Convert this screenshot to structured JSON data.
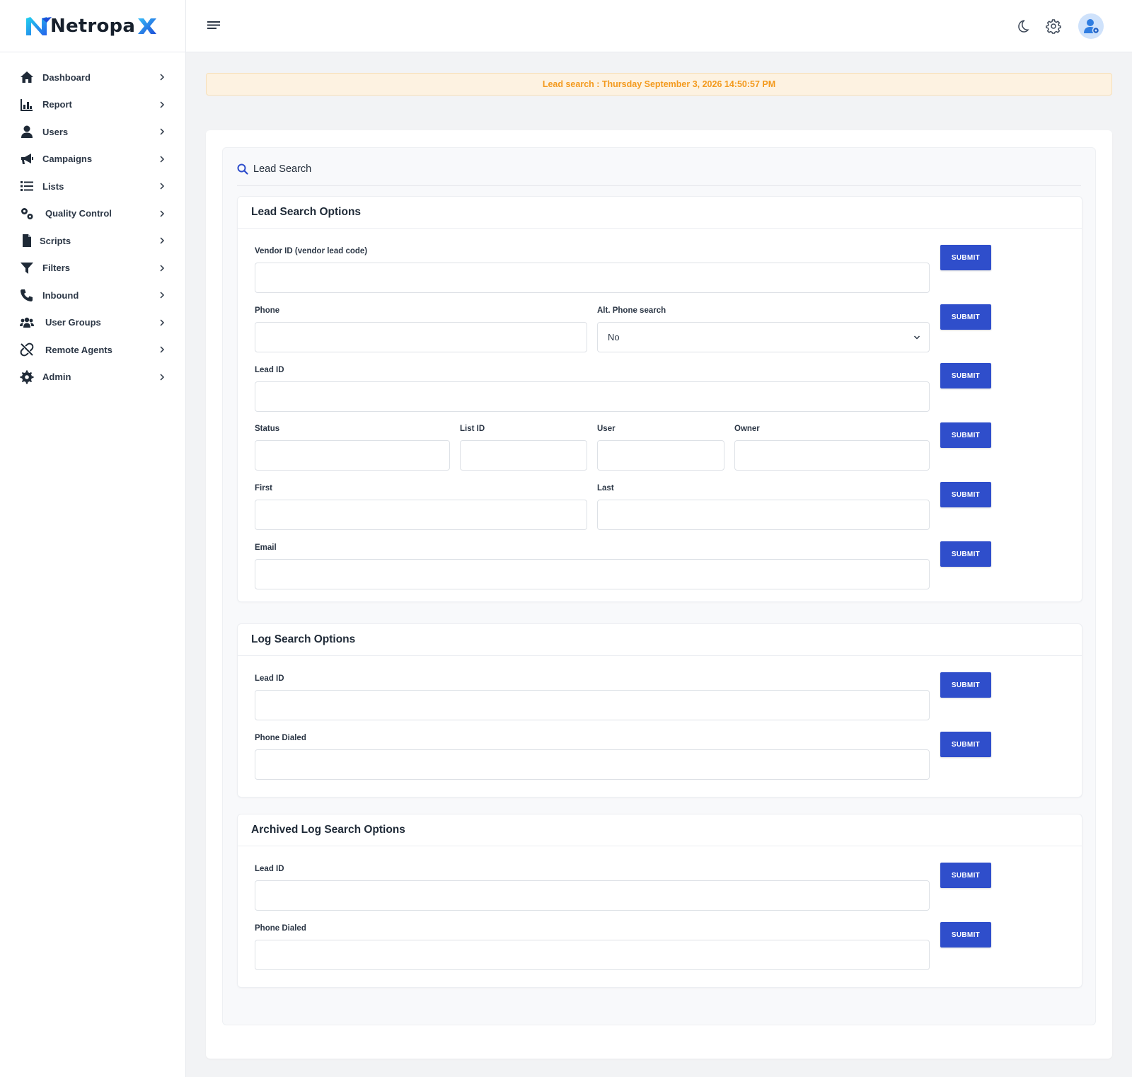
{
  "brand": {
    "name": "Netropa",
    "accent": "#2f4ecb"
  },
  "sidebar": {
    "items": [
      {
        "label": "Dashboard",
        "icon": "home-icon"
      },
      {
        "label": "Report",
        "icon": "chart-icon"
      },
      {
        "label": "Users",
        "icon": "user-icon"
      },
      {
        "label": "Campaigns",
        "icon": "megaphone-icon"
      },
      {
        "label": "Lists",
        "icon": "list-icon"
      },
      {
        "label": "Quality Control",
        "icon": "cogs-icon"
      },
      {
        "label": "Scripts",
        "icon": "file-icon"
      },
      {
        "label": "Filters",
        "icon": "filter-icon"
      },
      {
        "label": "Inbound",
        "icon": "phone-icon"
      },
      {
        "label": "User Groups",
        "icon": "users-icon"
      },
      {
        "label": "Remote Agents",
        "icon": "unlink-icon"
      },
      {
        "label": "Admin",
        "icon": "gear-icon"
      }
    ]
  },
  "alert": {
    "text": "Lead search : Thursday September 3, 2026 14:50:57 PM"
  },
  "panel": {
    "title": "Lead Search"
  },
  "lead_search": {
    "title": "Lead Search Options",
    "vendor_id_label": "Vendor ID (vendor lead code)",
    "phone_label": "Phone",
    "alt_phone_label": "Alt. Phone search",
    "alt_phone_value": "No",
    "lead_id_label": "Lead ID",
    "status_label": "Status",
    "list_id_label": "List ID",
    "user_label": "User",
    "owner_label": "Owner",
    "first_label": "First",
    "last_label": "Last",
    "email_label": "Email"
  },
  "log_search": {
    "title": "Log Search Options",
    "lead_id_label": "Lead ID",
    "phone_dialed_label": "Phone Dialed"
  },
  "archived_search": {
    "title": "Archived Log Search Options",
    "lead_id_label": "Lead ID",
    "phone_dialed_label": "Phone Dialed"
  },
  "submit_label": "SUBMIT"
}
